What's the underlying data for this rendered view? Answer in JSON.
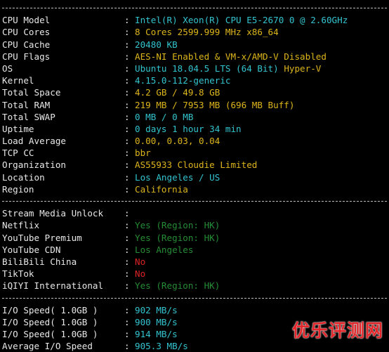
{
  "system": {
    "rows": [
      {
        "label": "CPU Model",
        "value": "Intel(R) Xeon(R) CPU E5-2670 0 @ 2.60GHz",
        "color": "cyan"
      },
      {
        "label": "CPU Cores",
        "value": "8 Cores 2599.999 MHz x86_64",
        "color": "yellow"
      },
      {
        "label": "CPU Cache",
        "value": "20480 KB",
        "color": "cyan"
      },
      {
        "label": "CPU Flags",
        "value": "AES-NI Enabled & VM-x/AMD-V Disabled",
        "color": "yellow"
      },
      {
        "label": "OS",
        "value": "Ubuntu 18.04.5 LTS (64 Bit)",
        "extra": "Hyper-V",
        "color": "cyan"
      },
      {
        "label": "Kernel",
        "value": "4.15.0-112-generic",
        "color": "cyan"
      },
      {
        "label": "Total Space",
        "value": "4.2 GB / 49.8 GB",
        "color": "yellow"
      },
      {
        "label": "Total RAM",
        "value": "219 MB / 7953 MB (696 MB Buff)",
        "color": "yellow"
      },
      {
        "label": "Total SWAP",
        "value": "0 MB / 0 MB",
        "color": "cyan"
      },
      {
        "label": "Uptime",
        "value": "0 days 1 hour 34 min",
        "color": "cyan"
      },
      {
        "label": "Load Average",
        "value": "0.00, 0.03, 0.04",
        "color": "yellow"
      },
      {
        "label": "TCP CC",
        "value": "bbr",
        "color": "yellow"
      },
      {
        "label": "Organization",
        "value": "AS55933 Cloudie Limited",
        "color": "yellow"
      },
      {
        "label": "Location",
        "value": "Los Angeles / US",
        "color": "cyan"
      },
      {
        "label": "Region",
        "value": "California",
        "color": "yellow"
      }
    ]
  },
  "media": {
    "header": "Stream Media Unlock",
    "rows": [
      {
        "label": "Netflix",
        "value": "Yes (Region: HK)",
        "color": "dimgreen"
      },
      {
        "label": "YouTube Premium",
        "value": "Yes (Region: HK)",
        "color": "dimgreen"
      },
      {
        "label": "YouTube CDN",
        "value": "Los Angeles",
        "color": "dimgreen"
      },
      {
        "label": "BiliBili China",
        "value": "No",
        "color": "red"
      },
      {
        "label": "TikTok",
        "value": "No",
        "color": "red"
      },
      {
        "label": "iQIYI International",
        "value": "Yes (Region: HK)",
        "color": "dimgreen"
      }
    ]
  },
  "io": {
    "rows": [
      {
        "label": "I/O Speed( 1.0GB )",
        "value": "902 MB/s",
        "color": "cyan"
      },
      {
        "label": "I/O Speed( 1.0GB )",
        "value": "900 MB/s",
        "color": "cyan"
      },
      {
        "label": "I/O Speed( 1.0GB )",
        "value": "914 MB/s",
        "color": "cyan"
      },
      {
        "label": "Average I/O Speed",
        "value": "905.3 MB/s",
        "color": "cyan"
      }
    ]
  },
  "colon": ":",
  "watermark": "优乐评测网"
}
